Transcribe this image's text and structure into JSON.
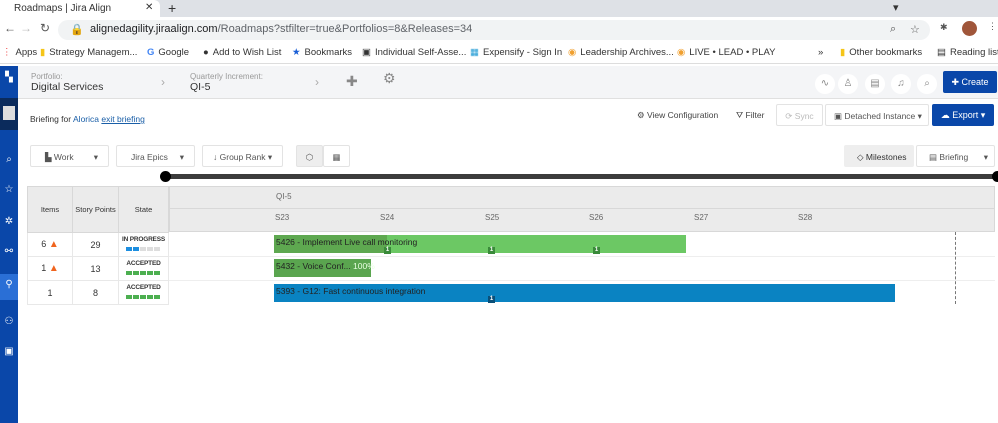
{
  "browser": {
    "tab_title": "Roadmaps | Jira Align",
    "url_host": "alignedagility.jiraalign.com",
    "url_path": "/Roadmaps?stfilter=true&Portfolios=8&Releases=34",
    "bookmarks": [
      "Apps",
      "Strategy Managem...",
      "Google",
      "Add to Wish List",
      "Bookmarks",
      "Individual Self-Asse...",
      "Expensify - Sign In",
      "Leadership Archives...",
      "LIVE • LEAD • PLAY"
    ],
    "other_bookmarks": "Other bookmarks",
    "reading_list": "Reading list"
  },
  "header": {
    "portfolio_label": "Portfolio:",
    "portfolio": "Digital Services",
    "pi_label": "Quarterly Increment:",
    "pi": "QI-5",
    "create": "Create"
  },
  "briefing": {
    "prefix": "Briefing for",
    "name": "Alorica",
    "exit": "exit briefing"
  },
  "actions": {
    "view_config": "View Configuration",
    "filter": "Filter",
    "sync": "Sync",
    "instance": "Detached Instance",
    "export": "Export"
  },
  "toolbar": {
    "work": "Work",
    "epics": "Jira Epics",
    "group_rank": "Group Rank",
    "milestones": "Milestones",
    "briefing": "Briefing"
  },
  "grid": {
    "headers": [
      "Items",
      "Story Points",
      "State"
    ],
    "increment": "QI-5",
    "sprints": [
      "S23",
      "S24",
      "S25",
      "S26",
      "S27",
      "S28"
    ],
    "rows": [
      {
        "items": "6",
        "warn": true,
        "points": "29",
        "state": "IN PROGRESS",
        "bar": "5426 - Implement Live call monitoring",
        "pct": "",
        "color": "#6cc864"
      },
      {
        "items": "1",
        "warn": true,
        "points": "13",
        "state": "ACCEPTED",
        "bar": "5432 - Voice Conf...",
        "pct": "100%",
        "color": "#5aa54f"
      },
      {
        "items": "1",
        "warn": false,
        "points": "8",
        "state": "ACCEPTED",
        "bar": "5393 - G12: Fast continuous integration",
        "pct": "",
        "color": "#0a83c2"
      }
    ],
    "badge": "1"
  }
}
